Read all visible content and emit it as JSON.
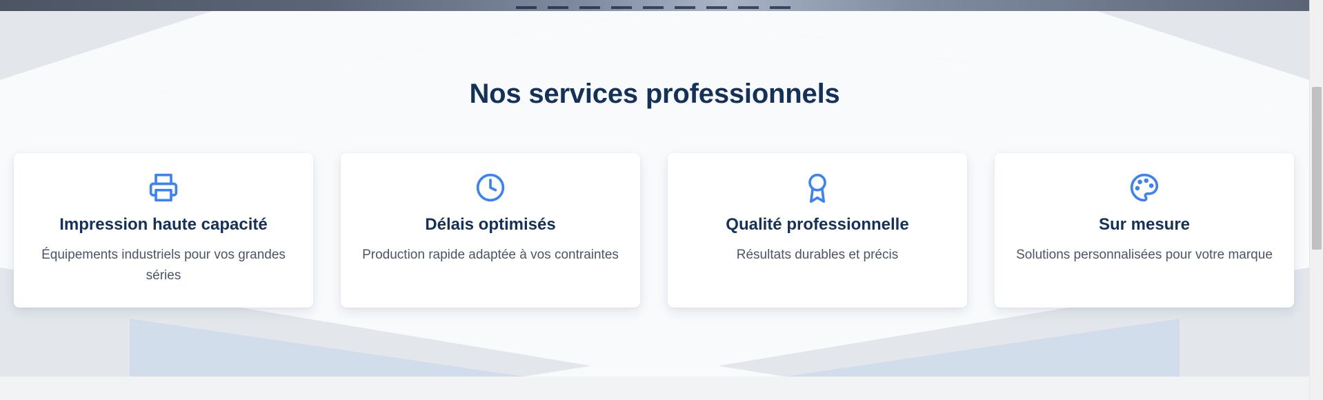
{
  "section": {
    "title": "Nos services professionnels"
  },
  "services": [
    {
      "icon": "printer-icon",
      "title": "Impression haute capacité",
      "description": "Équipements industriels pour vos grandes séries"
    },
    {
      "icon": "clock-icon",
      "title": "Délais optimisés",
      "description": "Production rapide adaptée à vos contraintes"
    },
    {
      "icon": "award-icon",
      "title": "Qualité professionnelle",
      "description": "Résultats durables et précis"
    },
    {
      "icon": "palette-icon",
      "title": "Sur mesure",
      "description": "Solutions personnalisées pour votre marque"
    }
  ],
  "colors": {
    "title": "#14315a",
    "icon": "#3b82f6",
    "text": "#4a5566",
    "card": "#ffffff",
    "section_bg": "#e3e7ec",
    "panel_bg": "#f8fafc",
    "accent_panel": "#d2ddec"
  }
}
